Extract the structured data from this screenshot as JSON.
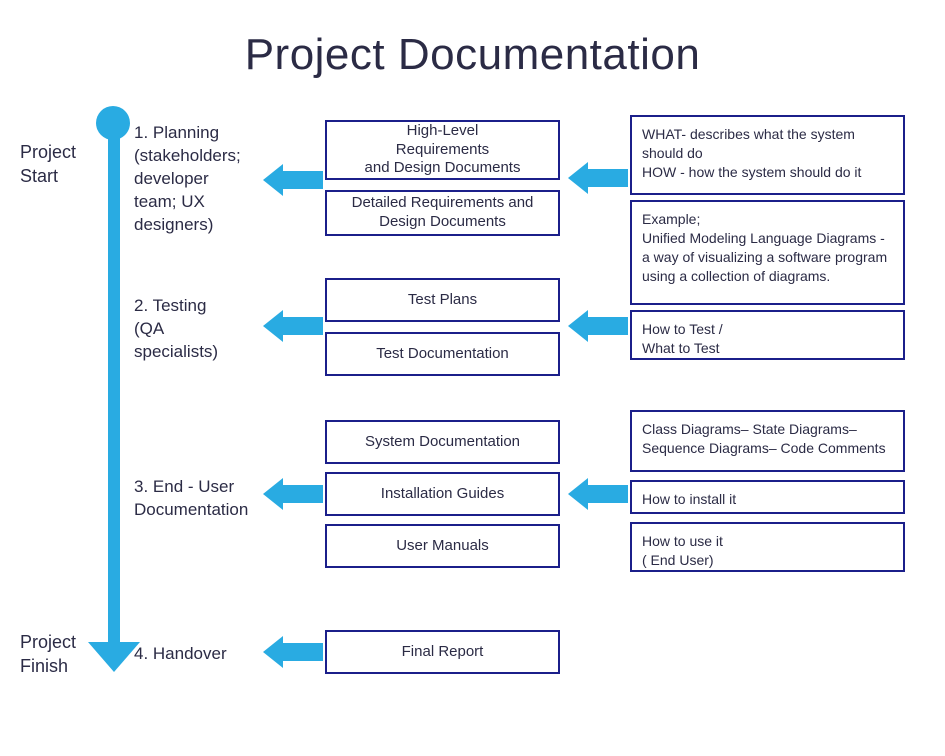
{
  "title": "Project  Documentation",
  "side": {
    "start": "Project\nStart",
    "finish": "Project\nFinish"
  },
  "phases": {
    "p1": "1. Planning\n(stakeholders;\ndeveloper\nteam; UX\ndesigners)",
    "p2": "2. Testing\n(QA\nspecialists)",
    "p3": "3. End - User\nDocumentation",
    "p4": "4. Handover"
  },
  "docs": {
    "d1": "High-Level\nRequirements\nand Design Documents",
    "d2": "Detailed Requirements and\nDesign Documents",
    "d3": "Test Plans",
    "d4": "Test Documentation",
    "d5": "System  Documentation",
    "d6": "Installation Guides",
    "d7": "User Manuals",
    "d8": "Final Report"
  },
  "desc": {
    "r1": "WHAT- describes what the system should do\nHOW - how the system should do it",
    "r2": "Example;\nUnified Modeling Language Diagrams - a way of visualizing a software program using a collection of diagrams.",
    "r3": "How to Test /\nWhat to Test",
    "r4": "Class Diagrams– State Diagrams– Sequence Diagrams– Code Comments",
    "r5": "How to install it",
    "r6": "How to use it\n( End User)"
  }
}
